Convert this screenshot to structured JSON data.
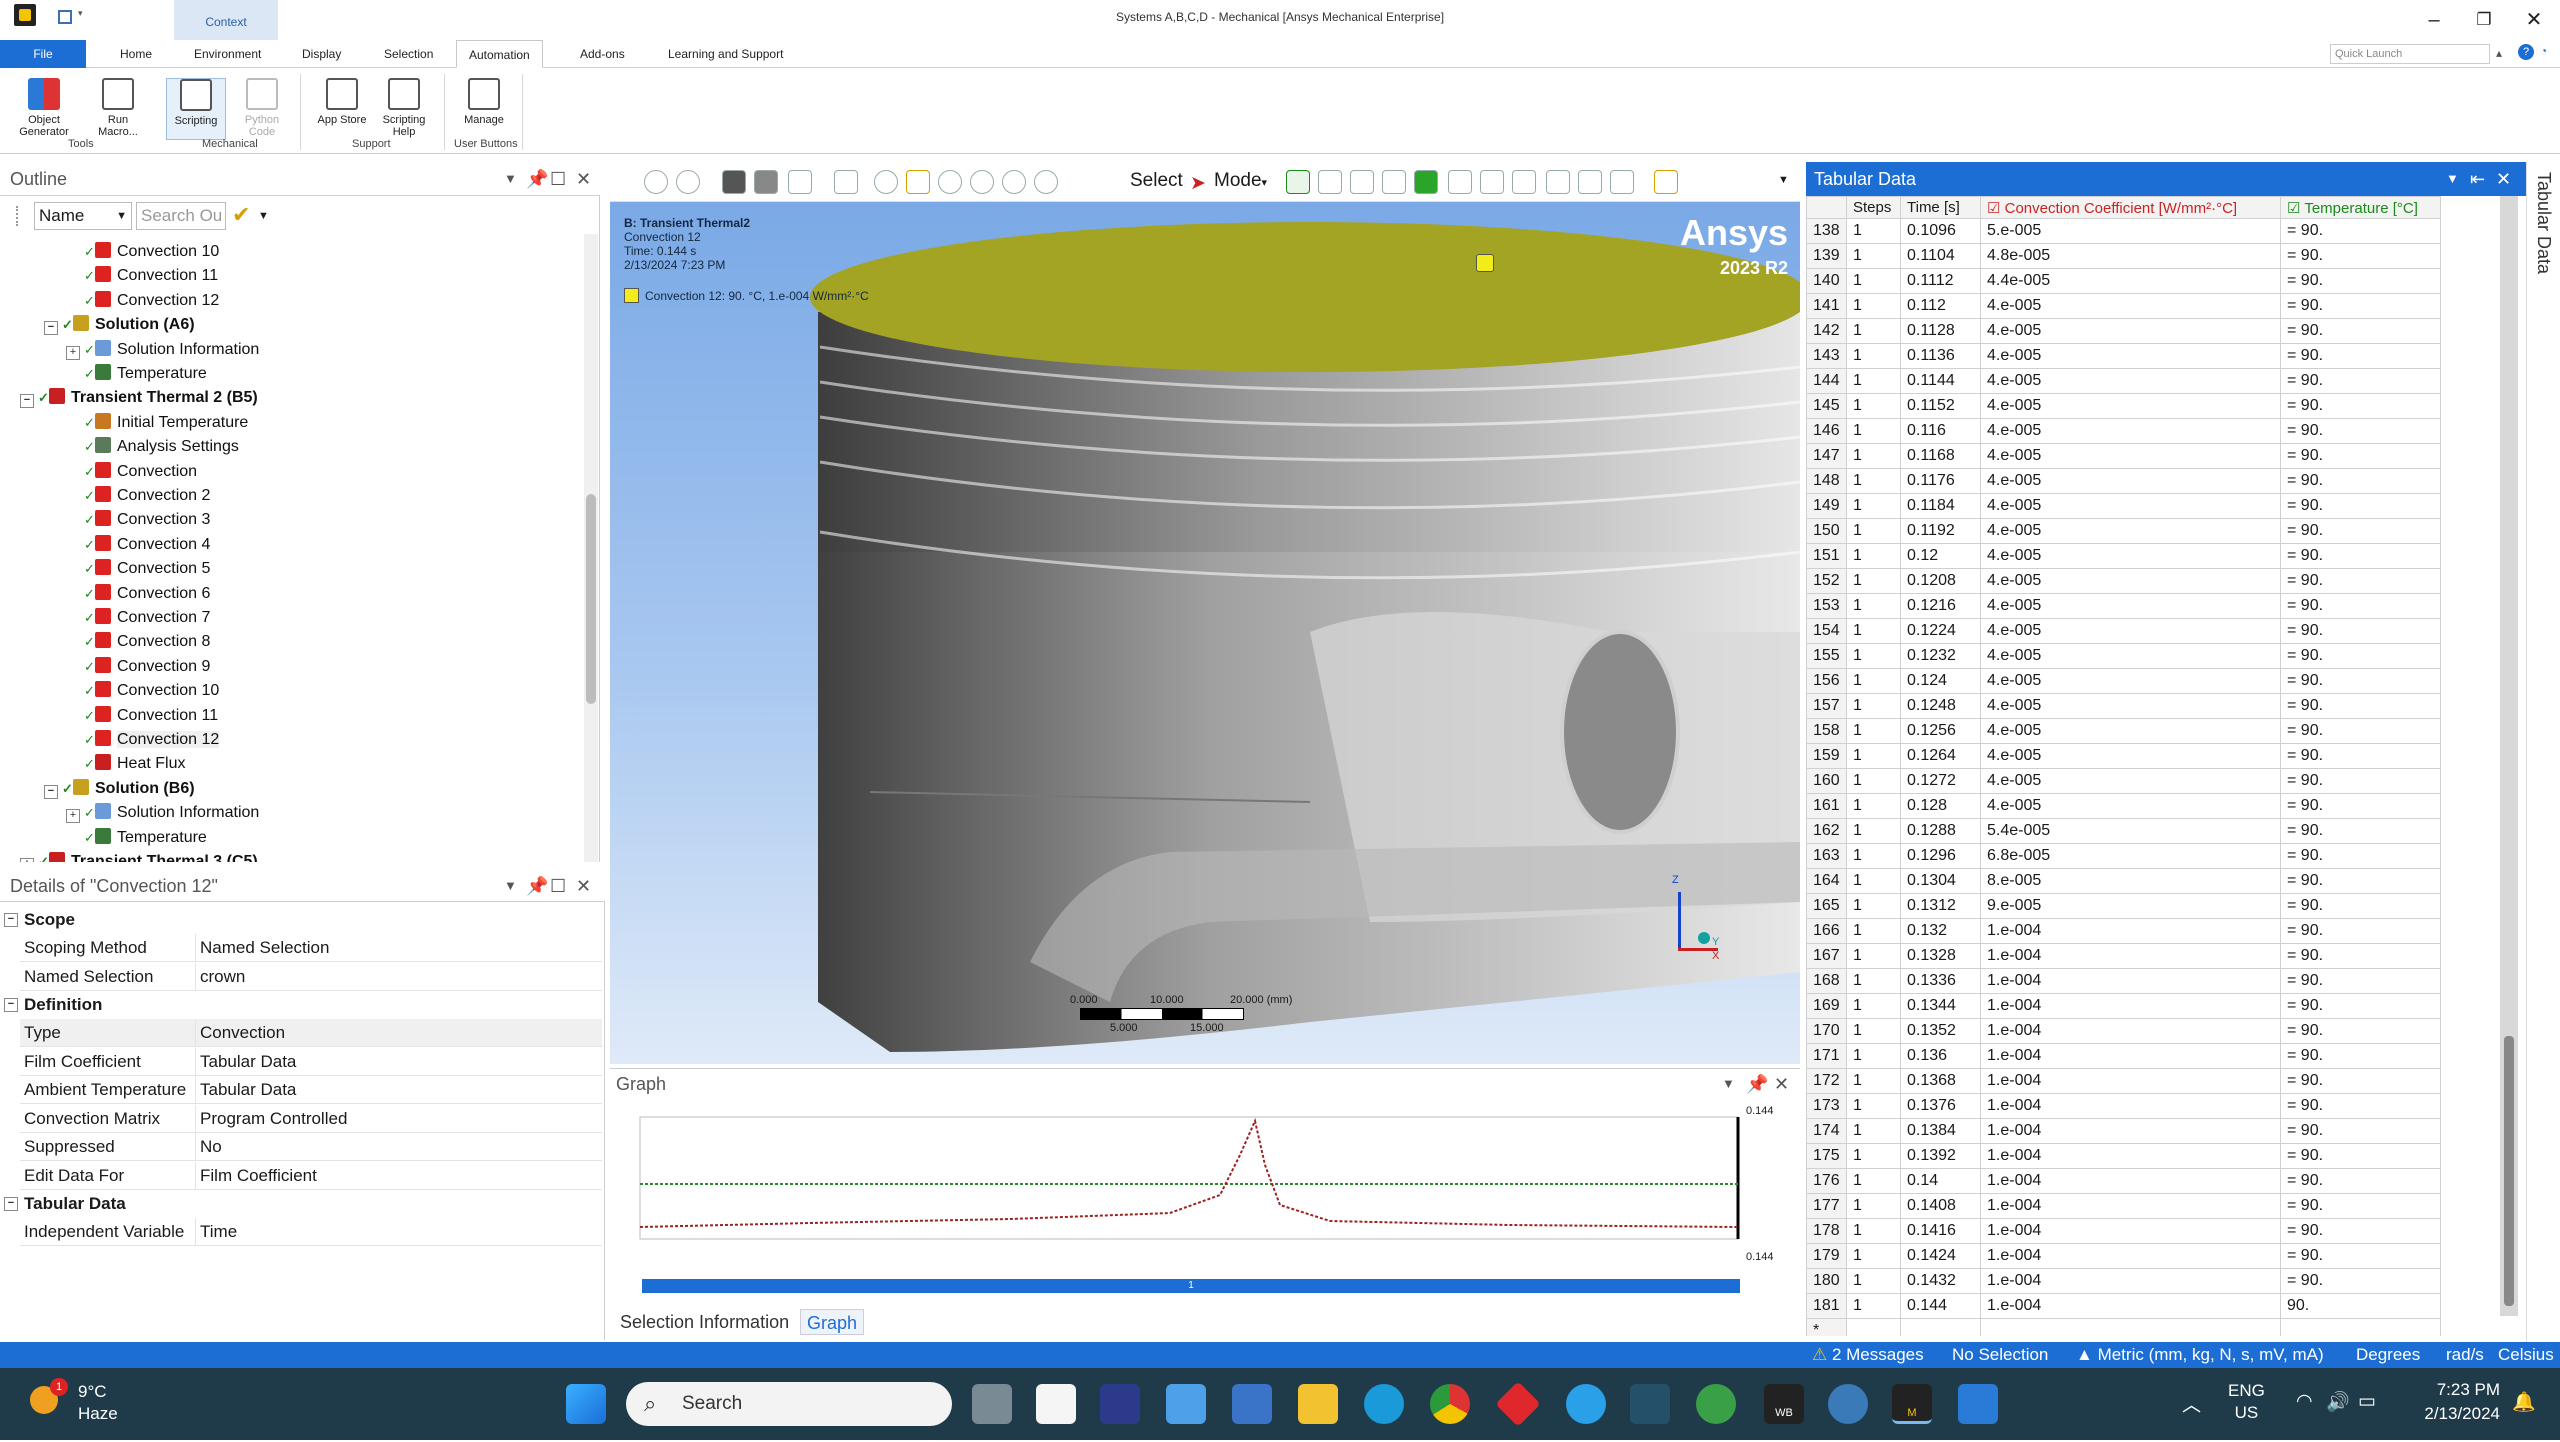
{
  "window": {
    "title": "Systems A,B,C,D - Mechanical [Ansys Mechanical Enterprise]",
    "context_tab": "Context",
    "quick_launch_placeholder": "Quick Launch"
  },
  "menu": {
    "file": "File",
    "items": [
      "Home",
      "Environment",
      "Display",
      "Selection",
      "Automation",
      "Add-ons",
      "Learning and Support"
    ],
    "active": "Automation"
  },
  "ribbon": {
    "buttons": [
      {
        "label": "Object Generator"
      },
      {
        "label": "Run Macro..."
      },
      {
        "label": "Scripting"
      },
      {
        "label": "Python Code"
      },
      {
        "label": "App Store"
      },
      {
        "label": "Scripting Help"
      },
      {
        "label": "Manage"
      }
    ],
    "groups": [
      "Tools",
      "Mechanical",
      "Support",
      "User Buttons"
    ]
  },
  "outline": {
    "title": "Outline",
    "name_column": "Name",
    "search_placeholder": "Search Ou",
    "nodes": [
      {
        "label": "Convection 10",
        "level": 3,
        "icon": "convection-icon"
      },
      {
        "label": "Convection 11",
        "level": 3,
        "icon": "convection-icon"
      },
      {
        "label": "Convection 12",
        "level": 3,
        "icon": "convection-icon"
      },
      {
        "label": "Solution (A6)",
        "level": 2,
        "bold": true,
        "expander": "−",
        "icon": "solution-icon"
      },
      {
        "label": "Solution Information",
        "level": 3,
        "expander": "+",
        "icon": "solution-information-icon"
      },
      {
        "label": "Temperature",
        "level": 3,
        "icon": "temperature-result-icon"
      },
      {
        "label": "Transient Thermal 2 (B5)",
        "level": 1,
        "bold": true,
        "expander": "−",
        "icon": "transient-thermal-icon"
      },
      {
        "label": "Initial Temperature",
        "level": 3,
        "icon": "initial-temperature-icon"
      },
      {
        "label": "Analysis Settings",
        "level": 3,
        "icon": "analysis-settings-icon"
      },
      {
        "label": "Convection",
        "level": 3,
        "icon": "convection-icon"
      },
      {
        "label": "Convection 2",
        "level": 3,
        "icon": "convection-icon"
      },
      {
        "label": "Convection 3",
        "level": 3,
        "icon": "convection-icon"
      },
      {
        "label": "Convection 4",
        "level": 3,
        "icon": "convection-icon"
      },
      {
        "label": "Convection 5",
        "level": 3,
        "icon": "convection-icon"
      },
      {
        "label": "Convection 6",
        "level": 3,
        "icon": "convection-icon"
      },
      {
        "label": "Convection 7",
        "level": 3,
        "icon": "convection-icon"
      },
      {
        "label": "Convection 8",
        "level": 3,
        "icon": "convection-icon"
      },
      {
        "label": "Convection 9",
        "level": 3,
        "icon": "convection-icon"
      },
      {
        "label": "Convection 10",
        "level": 3,
        "icon": "convection-icon"
      },
      {
        "label": "Convection 11",
        "level": 3,
        "icon": "convection-icon"
      },
      {
        "label": "Convection 12",
        "level": 3,
        "icon": "convection-icon",
        "selected": true
      },
      {
        "label": "Heat Flux",
        "level": 3,
        "icon": "heat-flux-icon"
      },
      {
        "label": "Solution (B6)",
        "level": 2,
        "bold": true,
        "expander": "−",
        "icon": "solution-icon"
      },
      {
        "label": "Solution Information",
        "level": 3,
        "expander": "+",
        "icon": "solution-information-icon"
      },
      {
        "label": "Temperature",
        "level": 3,
        "icon": "temperature-result-icon"
      },
      {
        "label": "Transient Thermal 3 (C5)",
        "level": 1,
        "bold": true,
        "expander": "+",
        "icon": "transient-thermal-icon"
      }
    ]
  },
  "details": {
    "title": "Details of \"Convection 12\"",
    "sections": [
      {
        "name": "Scope",
        "rows": [
          [
            "Scoping Method",
            "Named Selection"
          ],
          [
            "Named Selection",
            "crown"
          ]
        ]
      },
      {
        "name": "Definition",
        "rows": [
          [
            "Type",
            "Convection"
          ],
          [
            "Film Coefficient",
            "Tabular Data"
          ],
          [
            "Ambient Temperature",
            "Tabular Data"
          ],
          [
            "Convection Matrix",
            "Program Controlled"
          ],
          [
            "Suppressed",
            "No"
          ],
          [
            "Edit Data For",
            "Film Coefficient"
          ]
        ]
      },
      {
        "name": "Tabular Data",
        "rows": [
          [
            "Independent Variable",
            "Time"
          ]
        ]
      }
    ]
  },
  "toolbar": {
    "select_label": "Select",
    "mode_label": "Mode"
  },
  "viewport": {
    "analysis": "B: Transient Thermal2",
    "object": "Convection 12",
    "time": "Time: 0.144 s",
    "date": "2/13/2024 7:23 PM",
    "legend": "Convection 12: 90. °C, 1.e-004 W/mm²·°C",
    "brand": "Ansys",
    "version": "2023 R2",
    "scale_top": [
      "0.000",
      "10.000",
      "20.000 (mm)"
    ],
    "scale_bottom": [
      "5.000",
      "15.000"
    ],
    "axis": [
      "Z",
      "Y",
      "X"
    ],
    "colors": {
      "crown": "#a3a324",
      "legend_box": "#f2ec1a",
      "background_top": "#7aa9e6",
      "background_bottom": "#dfeaf8"
    }
  },
  "graph": {
    "title": "Graph",
    "top_label": "0.144",
    "bottom_label": "0.144",
    "step_label": "1",
    "tabs": [
      "Selection Information",
      "Graph"
    ]
  },
  "tabular": {
    "title": "Tabular Data",
    "side_label": "Tabular Data",
    "columns": [
      "Steps",
      "Time [s]",
      "Convection Coefficient [W/mm²·°C]",
      "Temperature [°C]"
    ],
    "rows": [
      [
        "138",
        "1",
        "0.1096",
        "5.e-005",
        "= 90."
      ],
      [
        "139",
        "1",
        "0.1104",
        "4.8e-005",
        "= 90."
      ],
      [
        "140",
        "1",
        "0.1112",
        "4.4e-005",
        "= 90."
      ],
      [
        "141",
        "1",
        "0.112",
        "4.e-005",
        "= 90."
      ],
      [
        "142",
        "1",
        "0.1128",
        "4.e-005",
        "= 90."
      ],
      [
        "143",
        "1",
        "0.1136",
        "4.e-005",
        "= 90."
      ],
      [
        "144",
        "1",
        "0.1144",
        "4.e-005",
        "= 90."
      ],
      [
        "145",
        "1",
        "0.1152",
        "4.e-005",
        "= 90."
      ],
      [
        "146",
        "1",
        "0.116",
        "4.e-005",
        "= 90."
      ],
      [
        "147",
        "1",
        "0.1168",
        "4.e-005",
        "= 90."
      ],
      [
        "148",
        "1",
        "0.1176",
        "4.e-005",
        "= 90."
      ],
      [
        "149",
        "1",
        "0.1184",
        "4.e-005",
        "= 90."
      ],
      [
        "150",
        "1",
        "0.1192",
        "4.e-005",
        "= 90."
      ],
      [
        "151",
        "1",
        "0.12",
        "4.e-005",
        "= 90."
      ],
      [
        "152",
        "1",
        "0.1208",
        "4.e-005",
        "= 90."
      ],
      [
        "153",
        "1",
        "0.1216",
        "4.e-005",
        "= 90."
      ],
      [
        "154",
        "1",
        "0.1224",
        "4.e-005",
        "= 90."
      ],
      [
        "155",
        "1",
        "0.1232",
        "4.e-005",
        "= 90."
      ],
      [
        "156",
        "1",
        "0.124",
        "4.e-005",
        "= 90."
      ],
      [
        "157",
        "1",
        "0.1248",
        "4.e-005",
        "= 90."
      ],
      [
        "158",
        "1",
        "0.1256",
        "4.e-005",
        "= 90."
      ],
      [
        "159",
        "1",
        "0.1264",
        "4.e-005",
        "= 90."
      ],
      [
        "160",
        "1",
        "0.1272",
        "4.e-005",
        "= 90."
      ],
      [
        "161",
        "1",
        "0.128",
        "4.e-005",
        "= 90."
      ],
      [
        "162",
        "1",
        "0.1288",
        "5.4e-005",
        "= 90."
      ],
      [
        "163",
        "1",
        "0.1296",
        "6.8e-005",
        "= 90."
      ],
      [
        "164",
        "1",
        "0.1304",
        "8.e-005",
        "= 90."
      ],
      [
        "165",
        "1",
        "0.1312",
        "9.e-005",
        "= 90."
      ],
      [
        "166",
        "1",
        "0.132",
        "1.e-004",
        "= 90."
      ],
      [
        "167",
        "1",
        "0.1328",
        "1.e-004",
        "= 90."
      ],
      [
        "168",
        "1",
        "0.1336",
        "1.e-004",
        "= 90."
      ],
      [
        "169",
        "1",
        "0.1344",
        "1.e-004",
        "= 90."
      ],
      [
        "170",
        "1",
        "0.1352",
        "1.e-004",
        "= 90."
      ],
      [
        "171",
        "1",
        "0.136",
        "1.e-004",
        "= 90."
      ],
      [
        "172",
        "1",
        "0.1368",
        "1.e-004",
        "= 90."
      ],
      [
        "173",
        "1",
        "0.1376",
        "1.e-004",
        "= 90."
      ],
      [
        "174",
        "1",
        "0.1384",
        "1.e-004",
        "= 90."
      ],
      [
        "175",
        "1",
        "0.1392",
        "1.e-004",
        "= 90."
      ],
      [
        "176",
        "1",
        "0.14",
        "1.e-004",
        "= 90."
      ],
      [
        "177",
        "1",
        "0.1408",
        "1.e-004",
        "= 90."
      ],
      [
        "178",
        "1",
        "0.1416",
        "1.e-004",
        "= 90."
      ],
      [
        "179",
        "1",
        "0.1424",
        "1.e-004",
        "= 90."
      ],
      [
        "180",
        "1",
        "0.1432",
        "1.e-004",
        "= 90."
      ],
      [
        "181",
        "1",
        "0.144",
        "1.e-004",
        "90."
      ]
    ],
    "new_row_marker": "*",
    "colors": {
      "conv_header": "#cc2222",
      "temp_header": "#1a8a1a"
    }
  },
  "status": {
    "messages": "2 Messages",
    "selection": "No Selection",
    "units": "Metric (mm, kg, N, s, mV, mA)",
    "angle": "Degrees",
    "rate": "rad/s",
    "temp": "Celsius"
  },
  "taskbar": {
    "weather_temp": "9°C",
    "weather_desc": "Haze",
    "weather_badge": "1",
    "search_placeholder": "Search",
    "language": "ENG",
    "region": "US",
    "time": "7:23 PM",
    "date": "2/13/2024",
    "wb_label": "WB",
    "m_label": "M"
  }
}
